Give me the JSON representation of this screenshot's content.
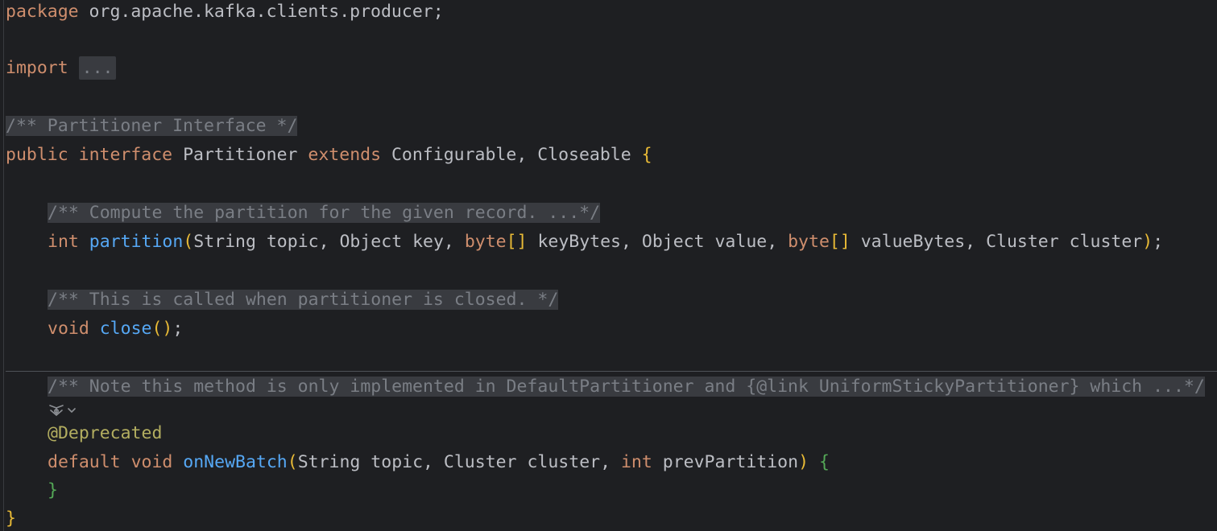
{
  "code": {
    "package_kw": "package",
    "package_name": " org.apache.kafka.clients.producer;",
    "import_kw": "import",
    "import_fold": "...",
    "interface_doc": "/** Partitioner Interface */",
    "public_kw": "public",
    "interface_kw": "interface",
    "class_name": "Partitioner",
    "extends_kw": "extends",
    "supertypes": "Configurable, Closeable",
    "open_brace": "{",
    "partition_doc": "/** Compute the partition for the given record. ...*/",
    "int_kw": "int",
    "partition_fn": "partition",
    "p_open": "(",
    "p_args1": "String topic, Object key,",
    "byte_kw": "byte",
    "brackets": "[]",
    "p_args2": "keyBytes, Object value,",
    "p_args3": "valueBytes, Cluster cluster",
    "p_close": ")",
    "semicolon": ";",
    "close_doc": "/** This is called when partitioner is closed. */",
    "void_kw": "void",
    "close_fn": "close",
    "empty_parens": "()",
    "batch_doc": "/** Note this method is only implemented in DefaultPartitioner and {@link UniformStickyPartitioner} which ...*/",
    "annotation": "@Deprecated",
    "default_kw": "default",
    "batch_fn": "onNewBatch",
    "b_args1": "String topic, Cluster cluster,",
    "b_args2": "prevPartition",
    "close_brace": "}"
  },
  "icons": {
    "inlay_hint": "ai-assistant-icon",
    "inlay_dropdown": "chevron-down-icon"
  }
}
